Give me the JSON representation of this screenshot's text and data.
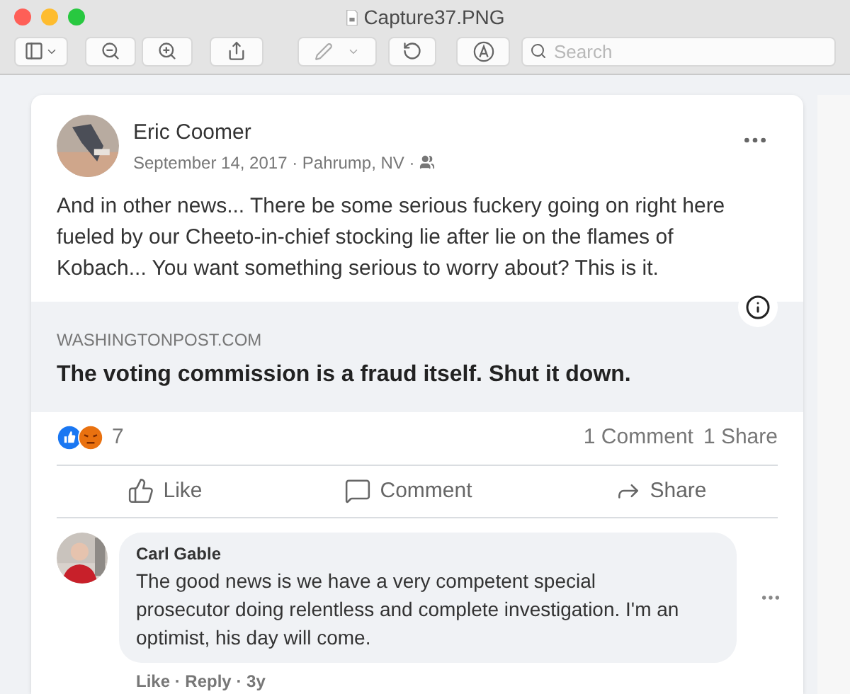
{
  "window": {
    "title": "Capture37.PNG"
  },
  "toolbar": {
    "search": {
      "placeholder": "Search"
    }
  },
  "post": {
    "author": "Eric Coomer",
    "meta": "September 14, 2017 · Pahrump, NV ·",
    "text": "And in other news... There be some serious fuckery going on right here fueled by our Cheeto-in-chief stocking lie after lie on the flames of Kobach... You want something serious to worry about? This is it.",
    "link": {
      "domain": "WASHINGTONPOST.COM",
      "title": "The voting commission is a fraud itself. Shut it down."
    },
    "reactions": {
      "count": "7"
    },
    "stats": [
      "1 Comment",
      "1 Share"
    ],
    "actions": [
      {
        "kind": "like",
        "label": "Like"
      },
      {
        "kind": "comment",
        "label": "Comment"
      },
      {
        "kind": "share",
        "label": "Share"
      }
    ]
  },
  "comments": [
    {
      "author": "Carl Gable",
      "text": "The good news is we have a very competent special prosecutor doing relentless and complete investigation. I'm an optimist, his day will come.",
      "footer": "Like · Reply · 3y"
    }
  ]
}
